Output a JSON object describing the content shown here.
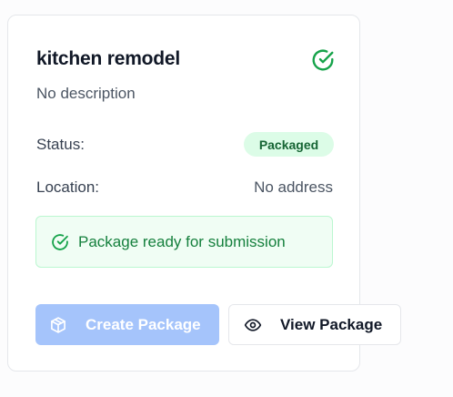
{
  "card": {
    "title": "kitchen remodel",
    "description": "No description",
    "status_label": "Status:",
    "status_value": "Packaged",
    "location_label": "Location:",
    "location_value": "No address",
    "notice_text": "Package ready for submission"
  },
  "actions": {
    "create_label": "Create Package",
    "view_label": "View Package"
  },
  "icons": {
    "title_icon": "check-circle-icon",
    "notice_icon": "check-circle-icon",
    "create_icon": "package-icon",
    "view_icon": "eye-icon"
  },
  "colors": {
    "success": "#16a34a",
    "badge_bg": "#dcfce7",
    "badge_text": "#166534",
    "notice_bg": "#f0fdf4",
    "notice_border": "#bbf7d0",
    "primary_disabled": "#a5c4fb"
  }
}
